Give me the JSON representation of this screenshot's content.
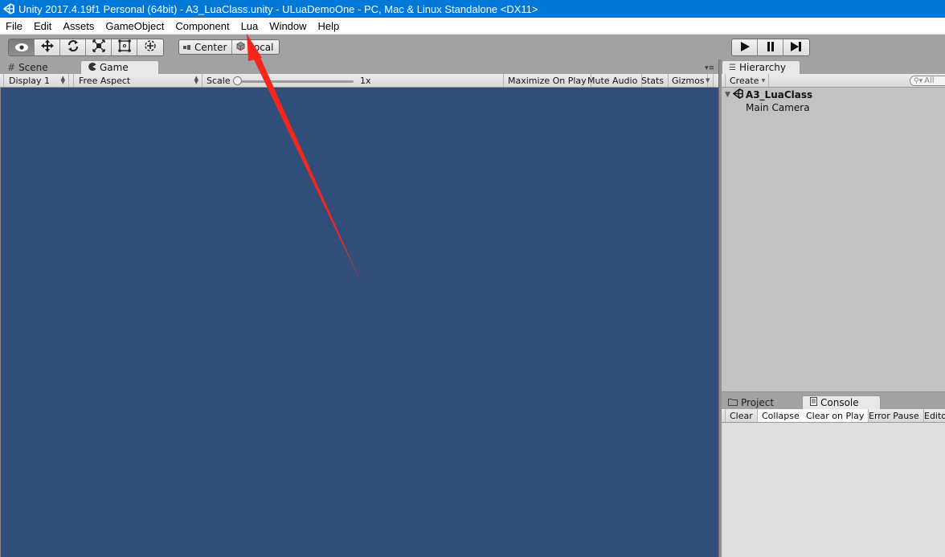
{
  "window": {
    "title": "Unity 2017.4.19f1 Personal (64bit) - A3_LuaClass.unity - ULuaDemoOne - PC, Mac & Linux Standalone <DX11>"
  },
  "menu": {
    "items": [
      "File",
      "Edit",
      "Assets",
      "GameObject",
      "Component",
      "Lua",
      "Window",
      "Help"
    ]
  },
  "toolbar": {
    "tools": [
      {
        "name": "view-tool",
        "icon": "eye-icon",
        "active": true
      },
      {
        "name": "move-tool",
        "icon": "move-arrows-icon",
        "active": false
      },
      {
        "name": "rotate-tool",
        "icon": "rotate-icon",
        "active": false
      },
      {
        "name": "scale-tool",
        "icon": "scale-icon",
        "active": false
      },
      {
        "name": "rect-tool",
        "icon": "rect-icon",
        "active": false
      },
      {
        "name": "transform-tool",
        "icon": "transform-icon",
        "active": false
      }
    ],
    "pivot_label": "Center",
    "space_label": "Local",
    "play_buttons": [
      "play-icon",
      "pause-icon",
      "step-icon"
    ]
  },
  "scene_tabs": {
    "scene_label": "Scene",
    "game_label": "Game",
    "active": "Game"
  },
  "game_toolbar": {
    "display": "Display 1",
    "aspect": "Free Aspect",
    "scale_label": "Scale",
    "scale_value": "1x",
    "scale_fraction": 0.0,
    "maximize_on_play": "Maximize On Play",
    "mute_audio": "Mute Audio",
    "stats": "Stats",
    "gizmos": "Gizmos"
  },
  "hierarchy": {
    "tab_label": "Hierarchy",
    "create_label": "Create",
    "search_placeholder": "All",
    "scene_name": "A3_LuaClass",
    "objects": [
      "Main Camera"
    ]
  },
  "bottom_tabs": {
    "project_label": "Project",
    "console_label": "Console",
    "active": "Console"
  },
  "console": {
    "buttons": [
      {
        "label": "Clear",
        "on": false
      },
      {
        "label": "Collapse",
        "on": true
      },
      {
        "label": "Clear on Play",
        "on": true
      },
      {
        "label": "Error Pause",
        "on": false
      },
      {
        "label": "Editor",
        "on": false
      }
    ]
  },
  "annotation": {
    "type": "red-arrow",
    "points_to": "Lua",
    "color": "#f5271c"
  },
  "colors": {
    "titlebar": "#0078d7",
    "game_view_bg": "#314d79",
    "editor_bg": "#a2a2a2"
  }
}
